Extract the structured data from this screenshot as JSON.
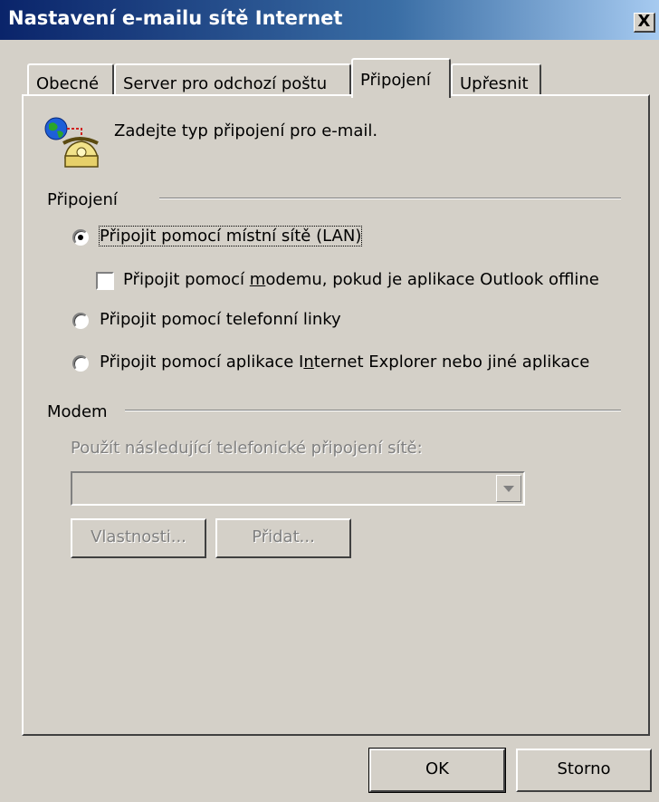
{
  "window": {
    "title": "Nastavení e-mailu sítě Internet",
    "close_glyph": "X"
  },
  "tabs": [
    {
      "label": "Obecné",
      "active": false
    },
    {
      "label": "Server pro odchozí poštu",
      "active": false
    },
    {
      "label": "Připojení",
      "active": true
    },
    {
      "label": "Upřesnit",
      "active": false
    }
  ],
  "intro": {
    "icon": "globe-phone-icon",
    "text": "Zadejte typ připojení pro e-mail."
  },
  "connection_group": {
    "title": "Připojení",
    "options": {
      "lan": {
        "label": "Připojit pomocí místní sítě (LAN)",
        "selected": true
      },
      "modem_offline": {
        "label_before": "Připojit pomocí ",
        "label_hotkey": "m",
        "label_after": "odemu, pokud je aplikace Outlook offline",
        "checked": false
      },
      "phone": {
        "label": "Připojit pomocí telefonní linky",
        "selected": false
      },
      "ie": {
        "label_before": "Připojit pomocí aplikace I",
        "label_hotkey": "n",
        "label_after": "ternet Explorer nebo jiné aplikace",
        "selected": false
      }
    }
  },
  "modem_group": {
    "title": "Modem",
    "dialup_label": "Použít následující telefonické připojení sítě:",
    "dialup_value": "",
    "properties_button": "Vlastnosti...",
    "add_button": "Přidat..."
  },
  "footer": {
    "ok_button": "OK",
    "cancel_button": "Storno"
  },
  "colors": {
    "face": "#d4d0c8",
    "title_start": "#0a246a",
    "title_end": "#a6caf0",
    "disabled_text": "#808080"
  }
}
